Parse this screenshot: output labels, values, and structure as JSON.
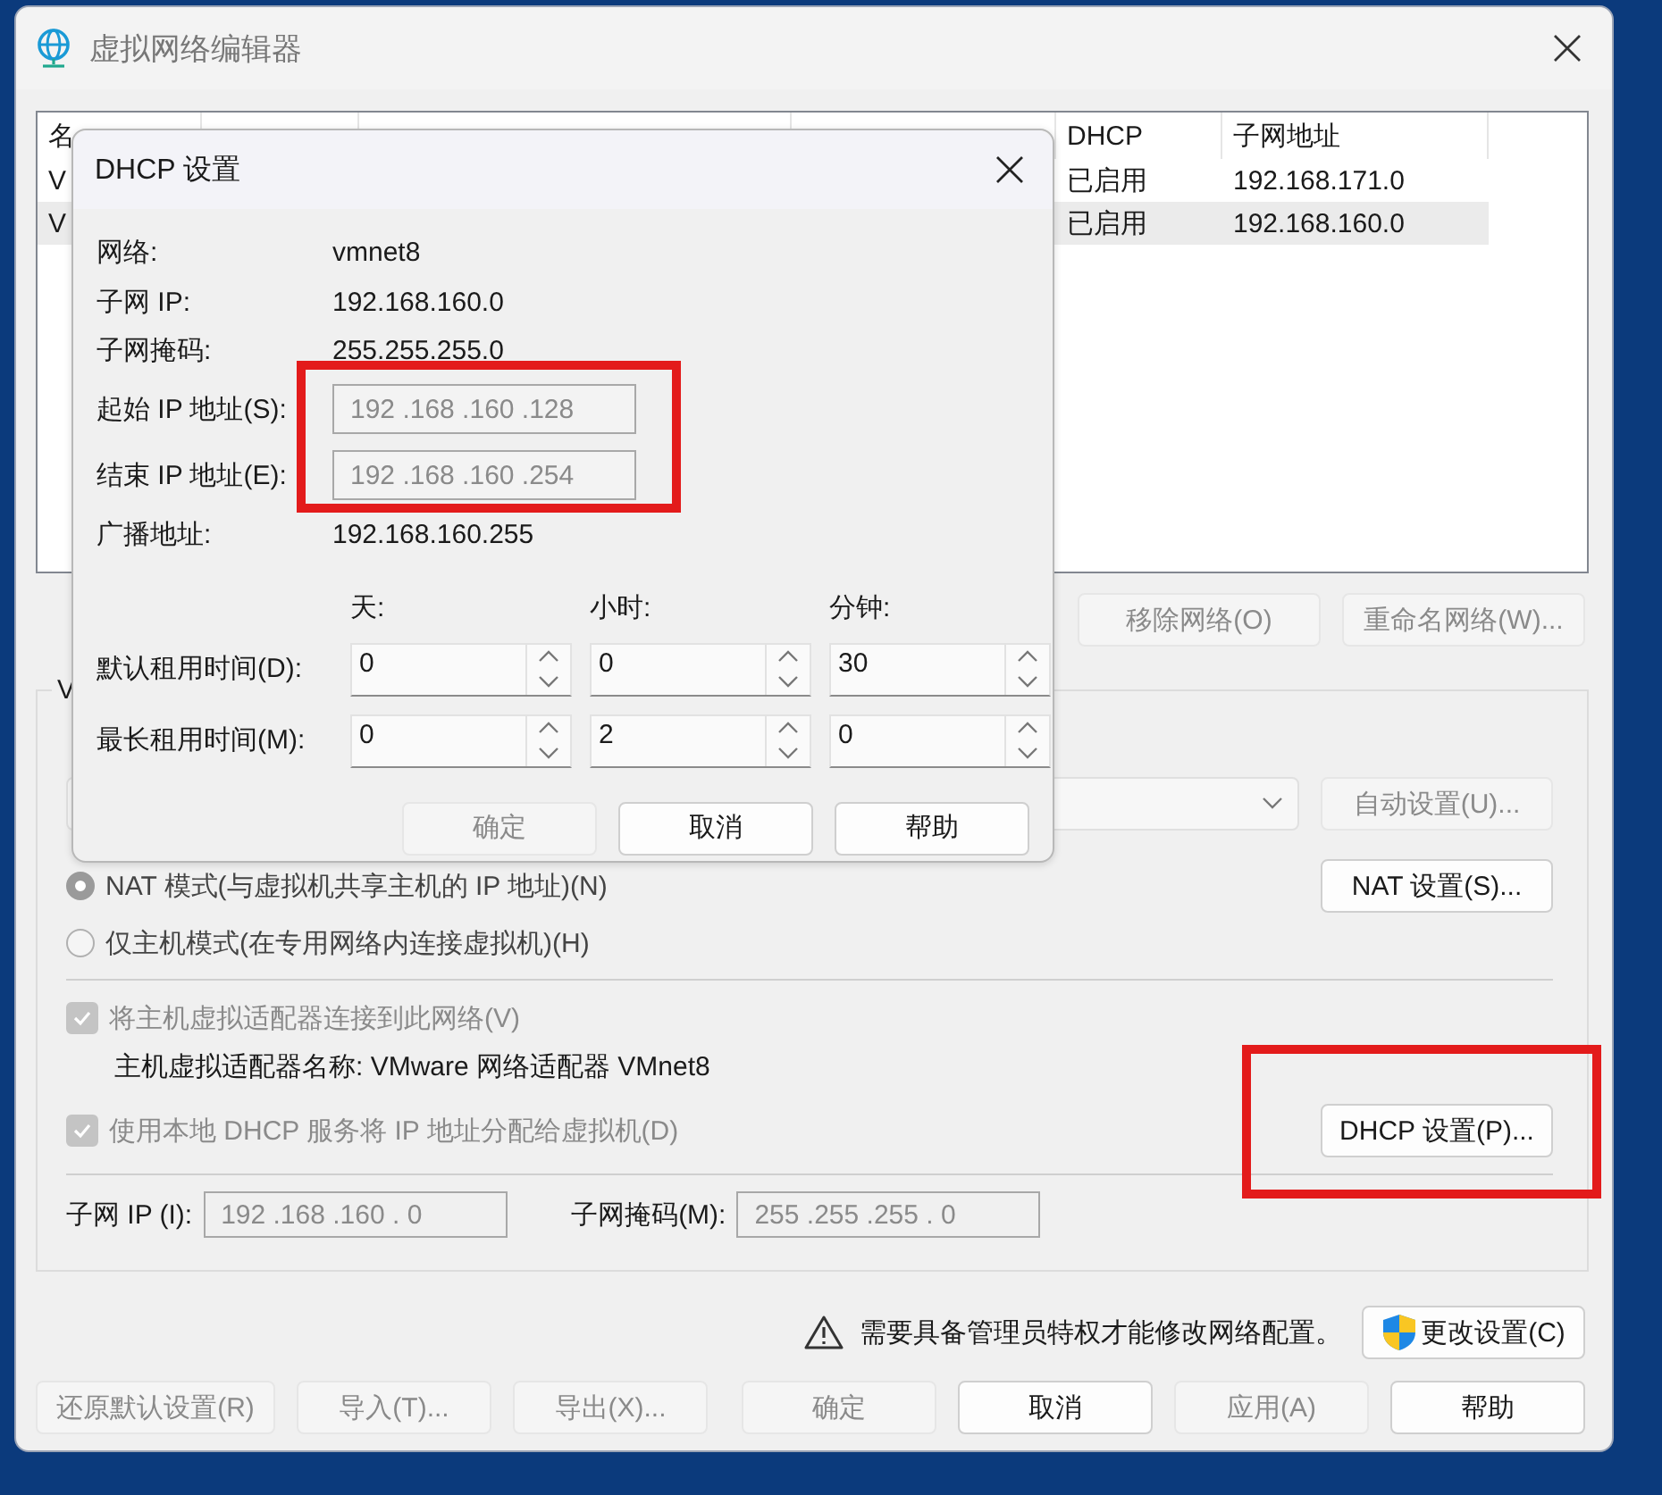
{
  "window": {
    "title": "虚拟网络编辑器"
  },
  "network_table": {
    "columns": [
      {
        "label": "名"
      },
      {},
      {},
      {},
      {
        "label": "DHCP"
      },
      {
        "label": "子网地址"
      }
    ],
    "rows": [
      {
        "name": "V",
        "dhcp": "已启用",
        "subnet": "192.168.171.0",
        "selected": false
      },
      {
        "name": "V",
        "dhcp": "已启用",
        "subnet": "192.168.160.0",
        "selected": true
      }
    ]
  },
  "table_buttons": [
    {
      "label": "移除网络(O)",
      "disabled": true
    },
    {
      "label": "重命名网络(W)...",
      "disabled": true
    }
  ],
  "vmnet_info": {
    "title": "V",
    "auto_button": {
      "label": "自动设置(U)...",
      "disabled": true
    },
    "modes": [
      {
        "label": "NAT 模式(与虚拟机共享主机的 IP 地址)(N)",
        "selected": true,
        "button": "NAT 设置(S)..."
      },
      {
        "label": "仅主机模式(在专用网络内连接虚拟机)(H)",
        "selected": false
      }
    ],
    "host_adapter": {
      "label": "将主机虚拟适配器连接到此网络(V)",
      "checked": true,
      "disabled": true
    },
    "adapter_name": "主机虚拟适配器名称: VMware 网络适配器 VMnet8",
    "dhcp_service": {
      "label": "使用本地 DHCP 服务将 IP 地址分配给虚拟机(D)",
      "checked": true,
      "disabled": true,
      "button": "DHCP 设置(P)..."
    },
    "subnet_ip": {
      "label": "子网 IP (I):",
      "value": "192 .168 .160 . 0",
      "disabled": true
    },
    "subnet_mask": {
      "label": "子网掩码(M):",
      "value": "255 .255 .255 . 0",
      "disabled": true
    }
  },
  "admin_notice": {
    "text": "需要具备管理员特权才能修改网络配置。",
    "button": "更改设置(C)"
  },
  "footer_buttons": [
    {
      "label": "还原默认设置(R)",
      "disabled": true
    },
    {
      "label": "导入(T)...",
      "disabled": true
    },
    {
      "label": "导出(X)...",
      "disabled": true
    },
    {
      "label": "确定",
      "disabled": true
    },
    {
      "label": "取消",
      "disabled": false
    },
    {
      "label": "应用(A)",
      "disabled": true
    },
    {
      "label": "帮助",
      "disabled": false
    }
  ],
  "dhcp_dialog": {
    "title": "DHCP 设置",
    "info": [
      {
        "label": "网络:",
        "value": "vmnet8"
      },
      {
        "label": "子网 IP:",
        "value": "192.168.160.0"
      },
      {
        "label": "子网掩码:",
        "value": "255.255.255.0"
      }
    ],
    "range": [
      {
        "label": "起始 IP 地址(S):",
        "value": "192 .168 .160 .128",
        "disabled": true
      },
      {
        "label": "结束 IP 地址(E):",
        "value": "192 .168 .160 .254",
        "disabled": true
      }
    ],
    "broadcast": {
      "label": "广播地址:",
      "value": "192.168.160.255"
    },
    "lease_units": [
      "天:",
      "小时:",
      "分钟:"
    ],
    "leases": [
      {
        "label": "默认租用时间(D):",
        "values": [
          "0",
          "0",
          "30"
        ]
      },
      {
        "label": "最长租用时间(M):",
        "values": [
          "0",
          "2",
          "0"
        ]
      }
    ],
    "buttons": [
      {
        "label": "确定",
        "disabled": true
      },
      {
        "label": "取消",
        "disabled": false
      },
      {
        "label": "帮助",
        "disabled": false
      }
    ]
  }
}
